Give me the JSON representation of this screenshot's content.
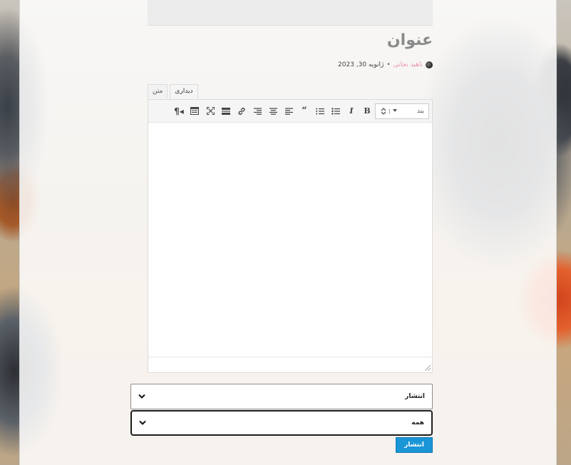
{
  "post": {
    "title": "عنوان",
    "author": "ناهید نجاتی",
    "date": "ژانویه 30, 2023"
  },
  "editor": {
    "tabs": [
      {
        "label": "دیداری",
        "active": true
      },
      {
        "label": "متن",
        "active": false
      }
    ],
    "format_select": "بند",
    "toolbar_icons": [
      "bold-icon",
      "italic-icon",
      "bullet-list-icon",
      "numbered-list-icon",
      "blockquote-icon",
      "align-left-icon",
      "align-center-icon",
      "align-right-icon",
      "link-icon",
      "read-more-icon",
      "fullscreen-icon",
      "toolbar-toggle-icon",
      "paragraph-rtl-icon"
    ]
  },
  "form": {
    "status_select": "انتشار",
    "visibility_select": "همه",
    "publish_button": "انتشار"
  },
  "colors": {
    "accent": "#1a95d6",
    "title": "#8a8a8a",
    "author": "#e98fb0"
  }
}
